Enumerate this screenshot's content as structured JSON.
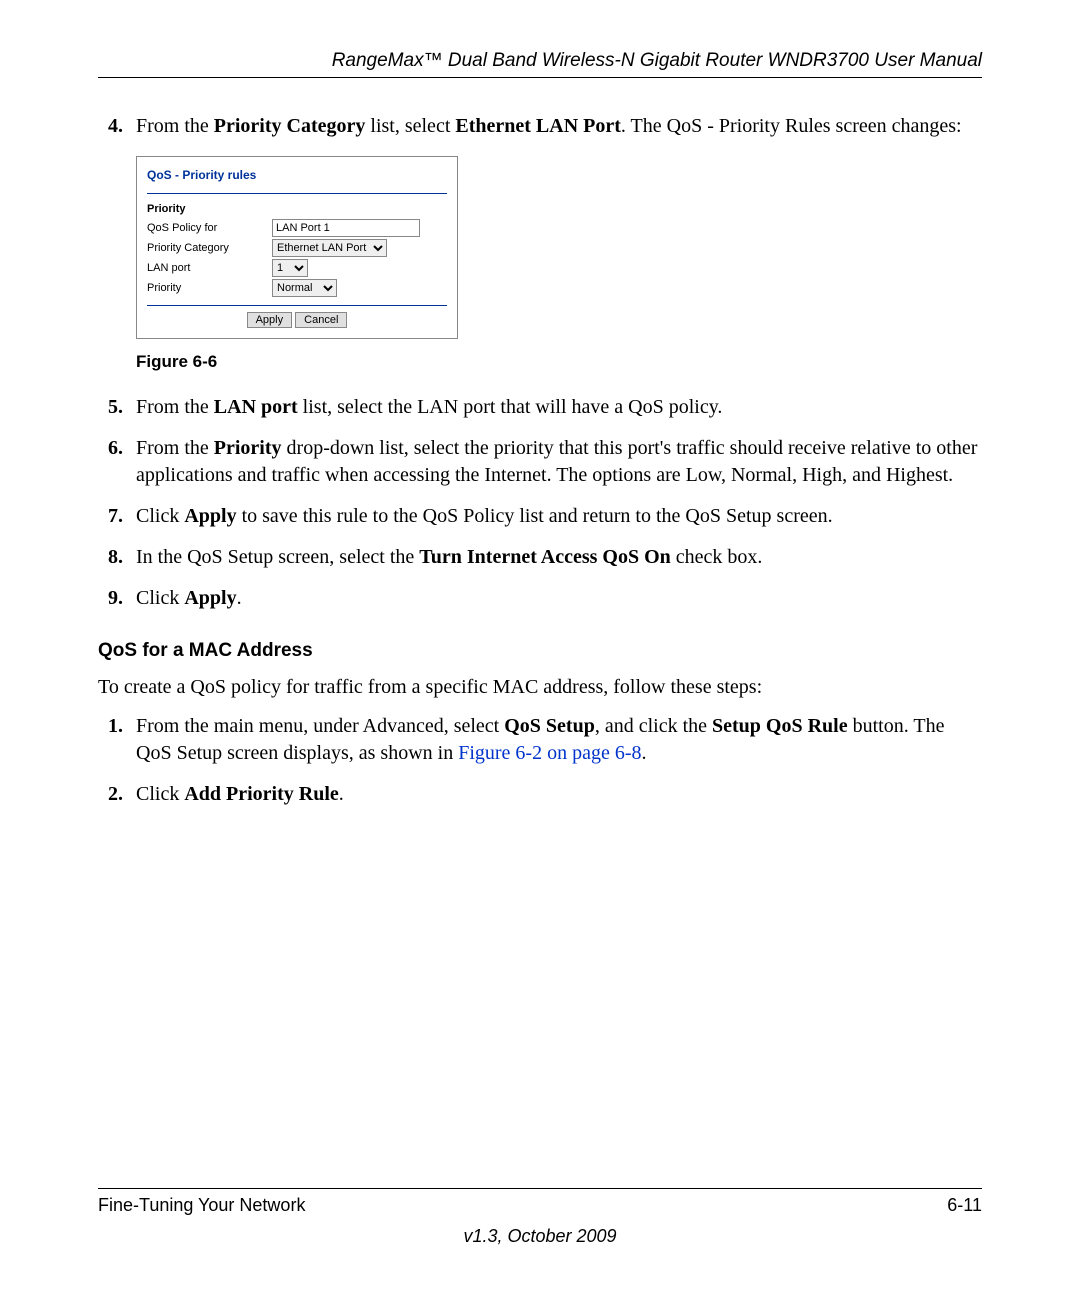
{
  "header": {
    "title": "RangeMax™ Dual Band Wireless-N Gigabit Router WNDR3700 User Manual"
  },
  "step4": {
    "pre": "From the ",
    "b1": "Priority Category",
    "mid": " list, select ",
    "b2": "Ethernet LAN Port",
    "post": ". The QoS - Priority Rules screen changes:"
  },
  "figure": {
    "title": "QoS - Priority rules",
    "section": "Priority",
    "rows": {
      "policy_label": "QoS Policy for",
      "policy_value": "LAN Port 1",
      "category_label": "Priority Category",
      "category_value": "Ethernet LAN Port",
      "lanport_label": "LAN port",
      "lanport_value": "1",
      "priority_label": "Priority",
      "priority_value": "Normal"
    },
    "buttons": {
      "apply": "Apply",
      "cancel": "Cancel"
    },
    "caption": "Figure 6-6"
  },
  "step5": {
    "pre": "From the ",
    "b1": "LAN port",
    "post": " list, select the LAN port that will have a QoS policy."
  },
  "step6": {
    "pre": "From the ",
    "b1": "Priority",
    "post": " drop-down list, select the priority that this port's traffic should receive relative to other applications and traffic when accessing the Internet. The options are Low, Normal, High, and Highest."
  },
  "step7": {
    "pre": "Click ",
    "b1": "Apply",
    "post": " to save this rule to the QoS Policy list and return to the QoS Setup screen."
  },
  "step8": {
    "pre": "In the QoS Setup screen, select the ",
    "b1": "Turn Internet Access QoS On",
    "post": " check box."
  },
  "step9": {
    "pre": "Click ",
    "b1": "Apply",
    "post": "."
  },
  "section2": {
    "heading": "QoS for a MAC Address",
    "intro": "To create a QoS policy for traffic from a specific MAC address, follow these steps:"
  },
  "step_m1": {
    "pre": "From the main menu, under Advanced, select ",
    "b1": "QoS Setup",
    "mid": ", and click the ",
    "b2": "Setup QoS Rule",
    "post": " button. The QoS Setup screen displays, as shown in ",
    "link": "Figure 6-2 on page 6-8",
    "end": "."
  },
  "step_m2": {
    "pre": "Click ",
    "b1": "Add Priority Rule",
    "post": "."
  },
  "footer": {
    "left": "Fine-Tuning Your Network",
    "right": "6-11",
    "version": "v1.3, October 2009"
  }
}
